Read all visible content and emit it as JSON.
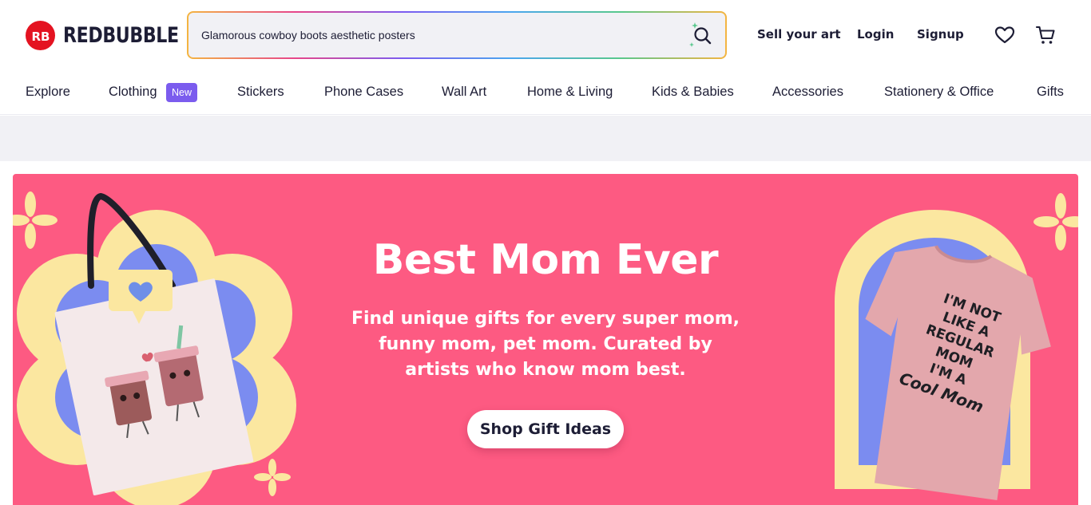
{
  "brand": {
    "name": "REDBUBBLE",
    "logo_mark": "RB",
    "color": "#e41321"
  },
  "search": {
    "value": "Glamorous cowboy boots aesthetic posters",
    "icon": "search-icon"
  },
  "header_links": {
    "sell": "Sell your art",
    "login": "Login",
    "signup": "Signup"
  },
  "header_icons": {
    "favorites": "heart-icon",
    "cart": "cart-icon"
  },
  "nav": {
    "items": [
      "Explore",
      "Clothing",
      "Stickers",
      "Phone Cases",
      "Wall Art",
      "Home & Living",
      "Kids & Babies",
      "Accessories",
      "Stationery & Office",
      "Gifts"
    ],
    "badge": "New",
    "badge_color": "#7b5cee"
  },
  "hero": {
    "title": "Best Mom Ever",
    "subtitle": "Find unique gifts for every super mom, funny mom, pet mom. Curated by artists who know mom best.",
    "cta": "Shop Gift Ideas",
    "background": "#fd5a82",
    "tshirt_text": [
      "I'M NOT",
      "LIKE A",
      "REGULAR",
      "MOM",
      "I'M A",
      "Cool Mom"
    ]
  }
}
